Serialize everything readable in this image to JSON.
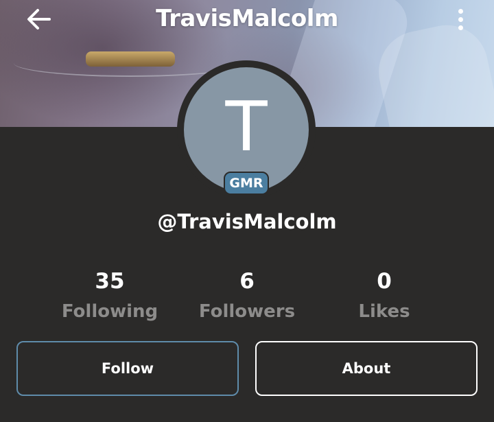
{
  "header": {
    "title": "TravisMalcolm",
    "back_icon": "arrow-left-icon",
    "menu_icon": "more-vertical-icon"
  },
  "profile": {
    "avatar_letter": "T",
    "avatar_color": "#8797a5",
    "badge": "GMR",
    "badge_color": "#4b7ea0",
    "handle": "@TravisMalcolm"
  },
  "stats": [
    {
      "value": "35",
      "label": "Following"
    },
    {
      "value": "6",
      "label": "Followers"
    },
    {
      "value": "0",
      "label": "Likes"
    }
  ],
  "actions": {
    "follow_label": "Follow",
    "about_label": "About"
  },
  "colors": {
    "background": "#2b2a29",
    "follow_border": "#5f8cab",
    "stat_label": "#8d8c8b"
  }
}
